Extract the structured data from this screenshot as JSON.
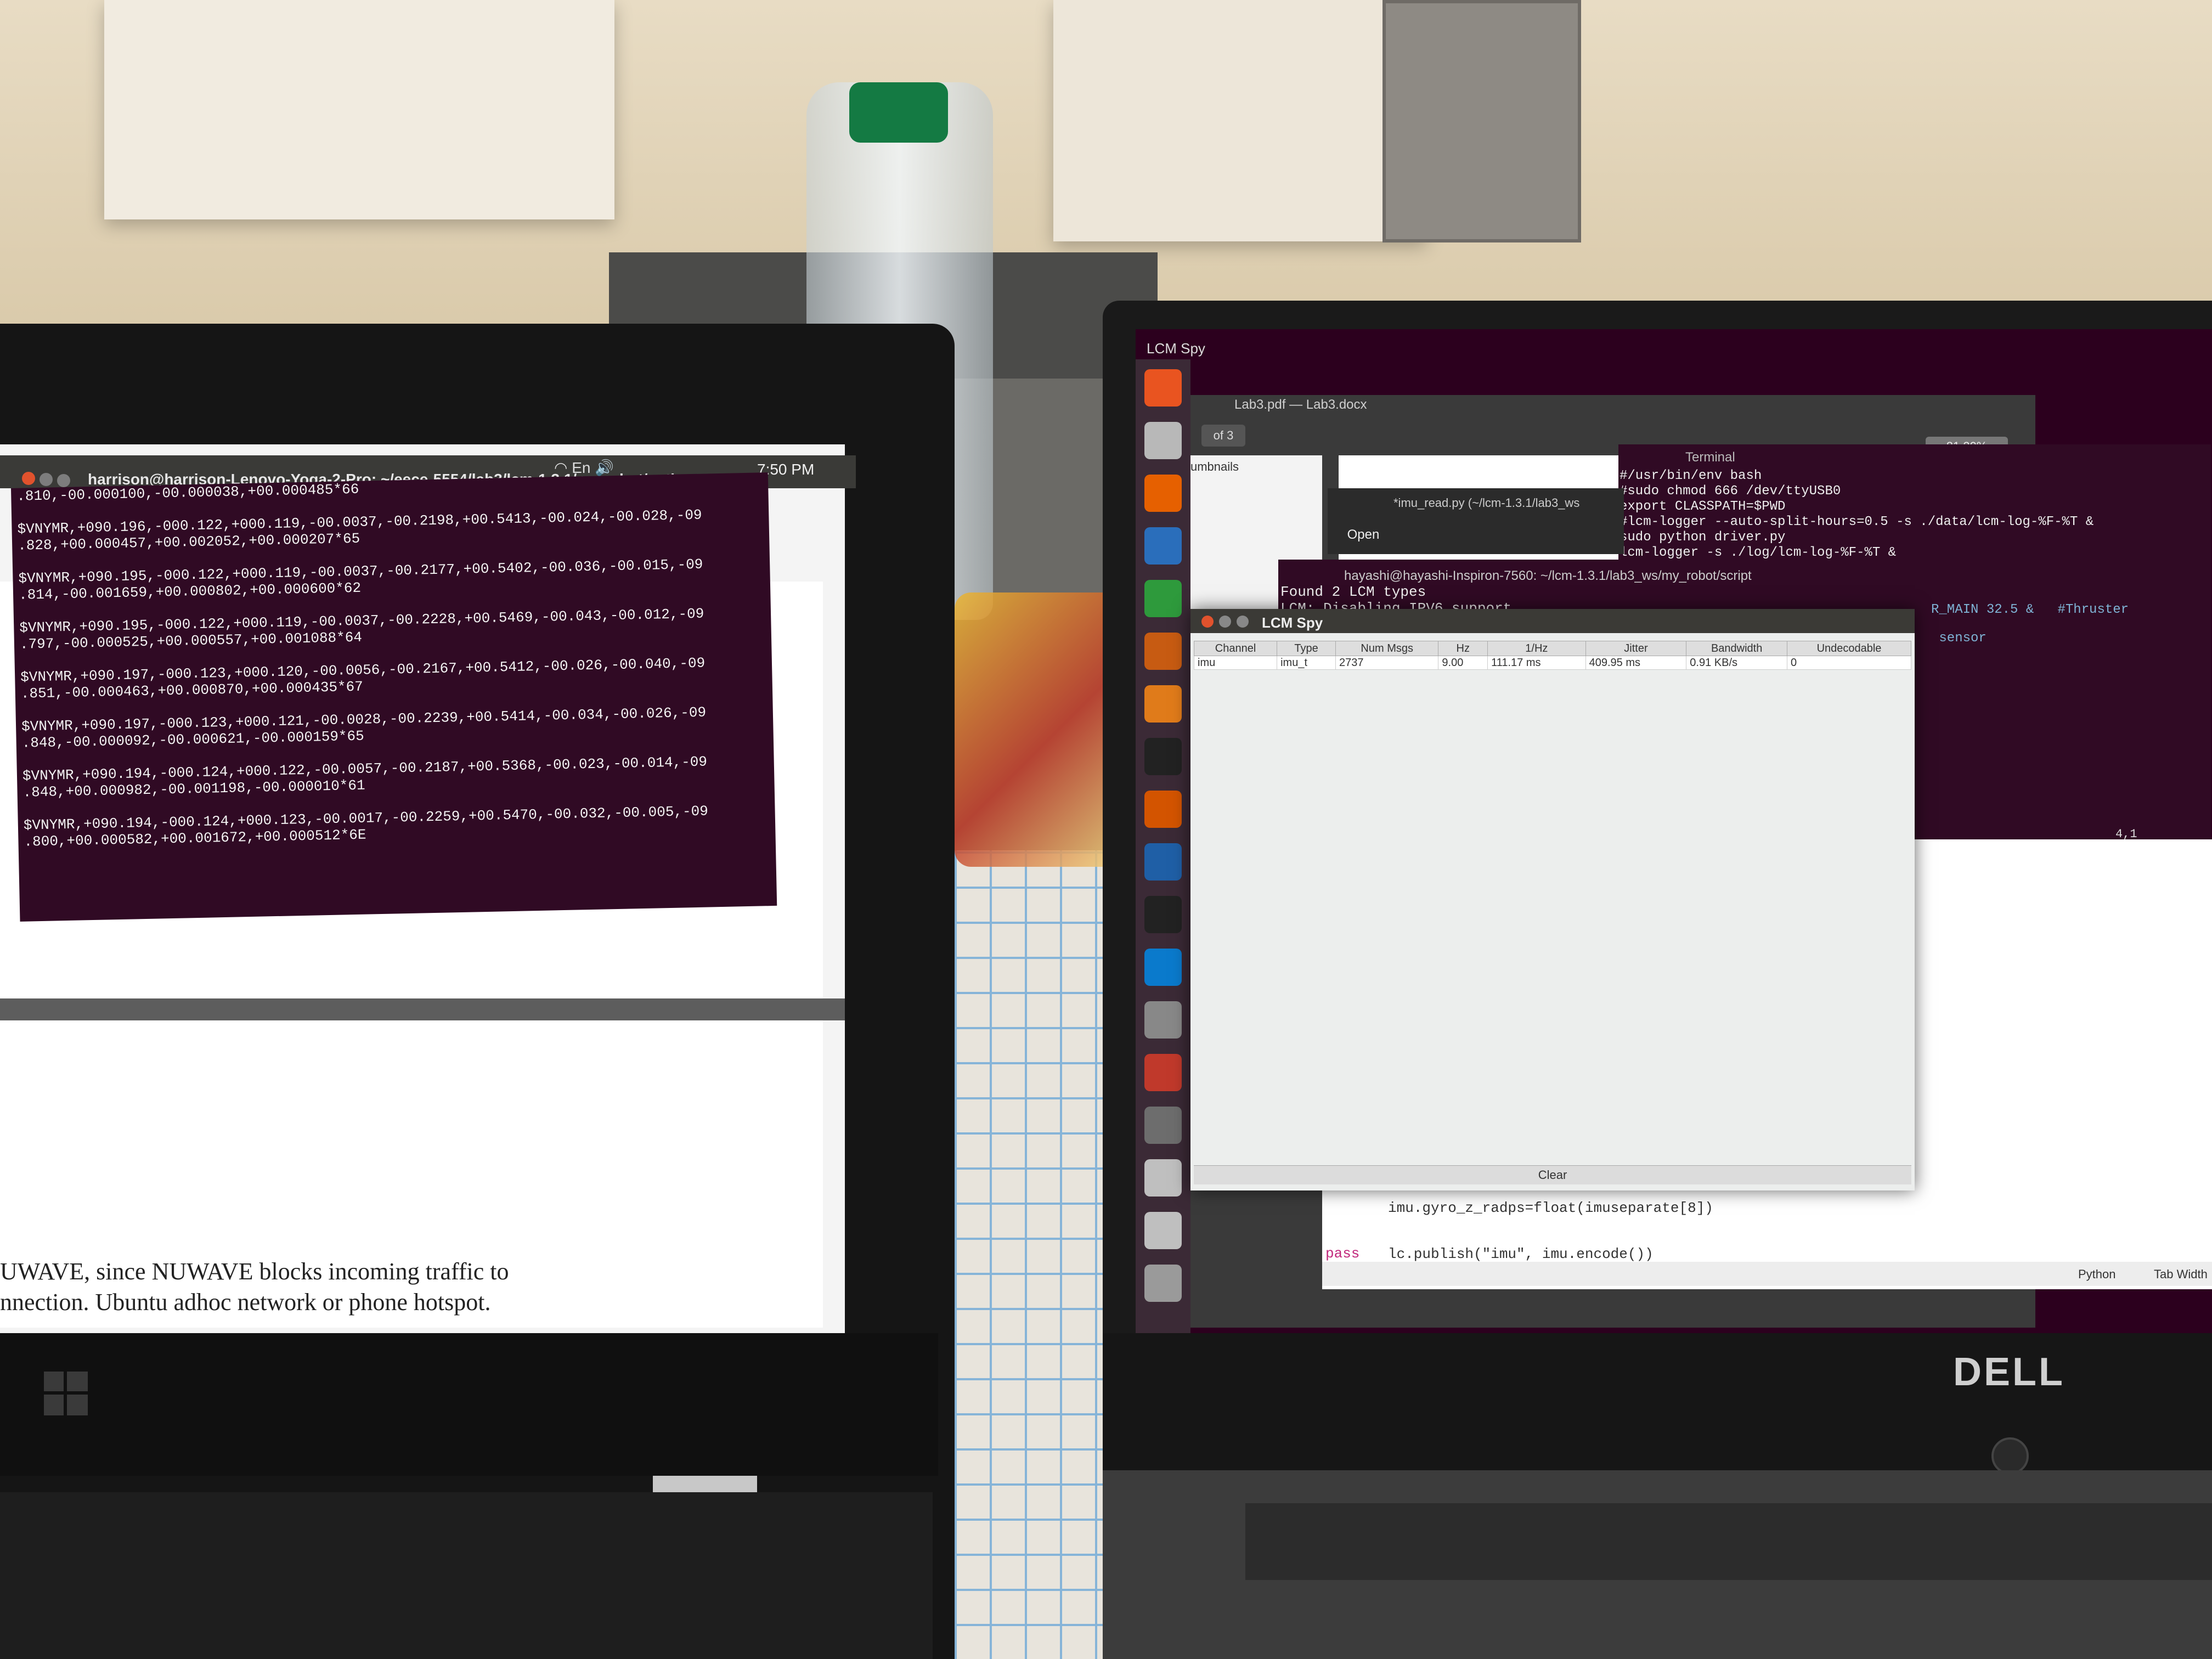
{
  "left_laptop": {
    "terminal_title": "harrison@harrison-Lenovo-Yoga-2-Pro: ~/eece-5554/lab3/lcm-1.3.1/my-robot/python",
    "clock": "7:50 PM",
    "input_lang": "En",
    "terminal_lines": [
      ".810,-00.000100,-00.000038,+00.000485*66",
      "",
      "$VNYMR,+090.196,-000.122,+000.119,-00.0037,-00.2198,+00.5413,-00.024,-00.028,-09",
      ".828,+00.000457,+00.002052,+00.000207*65",
      "",
      "$VNYMR,+090.195,-000.122,+000.119,-00.0037,-00.2177,+00.5402,-00.036,-00.015,-09",
      ".814,-00.001659,+00.000802,+00.000600*62",
      "",
      "$VNYMR,+090.195,-000.122,+000.119,-00.0037,-00.2228,+00.5469,-00.043,-00.012,-09",
      ".797,-00.000525,+00.000557,+00.001088*64",
      "",
      "$VNYMR,+090.197,-000.123,+000.120,-00.0056,-00.2167,+00.5412,-00.026,-00.040,-09",
      ".851,-00.000463,+00.000870,+00.000435*67",
      "",
      "$VNYMR,+090.197,-000.123,+000.121,-00.0028,-00.2239,+00.5414,-00.034,-00.026,-09",
      ".848,-00.000092,-00.000621,-00.000159*65",
      "",
      "$VNYMR,+090.194,-000.124,+000.122,-00.0057,-00.2187,+00.5368,-00.023,-00.014,-09",
      ".848,+00.000982,-00.001198,-00.000010*61",
      "",
      "$VNYMR,+090.194,-000.124,+000.123,-00.0017,-00.2259,+00.5470,-00.032,-00.005,-09",
      ".800,+00.000582,+00.001672,+00.000512*6E"
    ],
    "doc_text_1": "UWAVE, since NUWAVE blocks incoming traffic to",
    "doc_text_2": "nnection. Ubuntu adhoc network or phone hotspot."
  },
  "right_laptop": {
    "panel_title": "LCM Spy",
    "brand": "DELL",
    "pdf": {
      "title": "Lab3.pdf — Lab3.docx",
      "pages": "of 3",
      "thumbnails_label": "umbnails",
      "zoom": "81.20%"
    },
    "editor": {
      "title": "*imu_read.py (~/lcm-1.3.1/lab3_ws",
      "open_label": "Open",
      "code_line_1": "imu.gyro_z_radps=float(imuseparate[8])",
      "code_line_2": "lc.publish(\"imu\", imu.encode())",
      "pass_kw": "pass",
      "status_lang": "Python",
      "status_tab": "Tab Width"
    },
    "hayashi_terminal": {
      "title": "hayashi@hayashi-Inspiron-7560: ~/lcm-1.3.1/lab3_ws/my_robot/script",
      "lines": "Found 2 LCM types\nLCM: Disabling IPV6 support"
    },
    "bash_terminal": {
      "title": "Terminal",
      "lines": "#/usr/bin/env bash\n#sudo chmod 666 /dev/ttyUSB0\nexport CLASSPATH=$PWD\n#lcm-logger --auto-split-hours=0.5 -s ./data/lcm-log-%F-%T &\nsudo python driver.py\nlcm-logger -s ./log/lcm-log-%F-%T &",
      "side_text": "R_MAIN 32.5 &   #Thruster\n sensor",
      "position": "4,1"
    },
    "lcm_spy": {
      "title": "LCM Spy",
      "columns": [
        "Channel",
        "Type",
        "Num Msgs",
        "Hz",
        "1/Hz",
        "Jitter",
        "Bandwidth",
        "Undecodable"
      ],
      "rows": [
        [
          "imu",
          "imu_t",
          "2737",
          "9.00",
          "111.17 ms",
          "409.95 ms",
          "0.91 KB/s",
          "0"
        ]
      ],
      "clear_label": "Clear"
    },
    "launcher_icons": [
      "ubuntu-dash-icon",
      "files-icon",
      "firefox-icon",
      "writer-icon",
      "calc-icon",
      "impress-icon",
      "software-center-icon",
      "amazon-icon",
      "settings-icon",
      "matlab-icon",
      "terminal-icon",
      "vscode-icon",
      "text-editor-icon",
      "evince-icon",
      "gimp-icon",
      "drive-icon",
      "drive-icon",
      "trash-icon"
    ]
  }
}
